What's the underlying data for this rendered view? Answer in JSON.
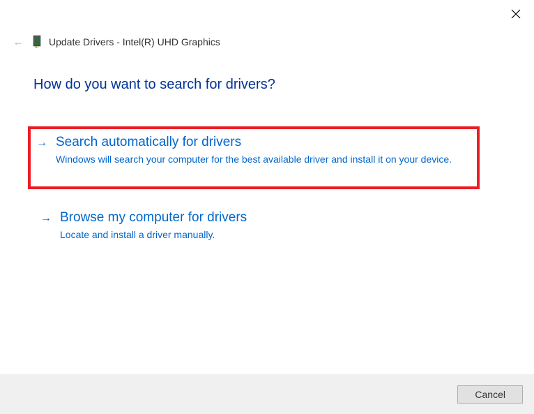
{
  "window": {
    "title": "Update Drivers - Intel(R) UHD Graphics"
  },
  "heading": "How do you want to search for drivers?",
  "options": [
    {
      "title": "Search automatically for drivers",
      "description": "Windows will search your computer for the best available driver and install it on your device."
    },
    {
      "title": "Browse my computer for drivers",
      "description": "Locate and install a driver manually."
    }
  ],
  "footer": {
    "cancel": "Cancel"
  }
}
